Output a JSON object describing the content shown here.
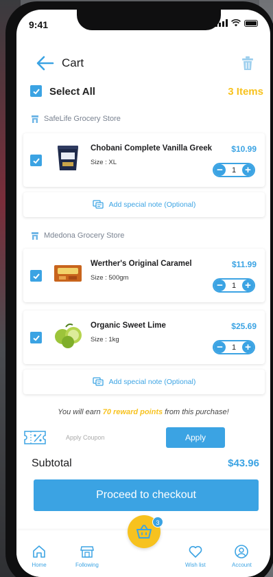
{
  "status": {
    "time": "9:41"
  },
  "header": {
    "title": "Cart"
  },
  "select_all": {
    "label": "Select All",
    "count": "3 Items"
  },
  "stores": [
    {
      "name": "SafeLife Grocery Store",
      "items": [
        {
          "name": "Chobani Complete Vanilla Greek",
          "size": "Size : XL",
          "price": "$10.99",
          "qty": "1",
          "selected": true
        }
      ],
      "note": "Add special note (Optional)"
    },
    {
      "name": "Mdedona Grocery Store",
      "items": [
        {
          "name": "Werther's Original Caramel",
          "size": "Size : 500gm",
          "price": "$11.99",
          "qty": "1",
          "selected": true
        },
        {
          "name": "Organic Sweet Lime",
          "size": "Size : 1kg",
          "price": "$25.69",
          "qty": "1",
          "selected": true
        }
      ],
      "note": "Add special note (Optional)"
    }
  ],
  "reward": {
    "prefix": "You will earn ",
    "highlight": "70 reward points",
    "suffix": " from this purchase!"
  },
  "coupon": {
    "placeholder": "Apply Coupon",
    "apply_label": "Apply"
  },
  "subtotal": {
    "label": "Subtotal",
    "value": "$43.96"
  },
  "checkout": {
    "label": "Proceed to checkout"
  },
  "cart_badge": "3",
  "tabs": [
    {
      "label": "Home",
      "icon": "home-icon"
    },
    {
      "label": "Following",
      "icon": "store-icon"
    },
    {
      "label": "Wish list",
      "icon": "heart-icon"
    },
    {
      "label": "Account",
      "icon": "account-icon"
    }
  ],
  "colors": {
    "primary": "#3ba3e3",
    "accent": "#f7c21f",
    "text": "#1d1d1f"
  }
}
